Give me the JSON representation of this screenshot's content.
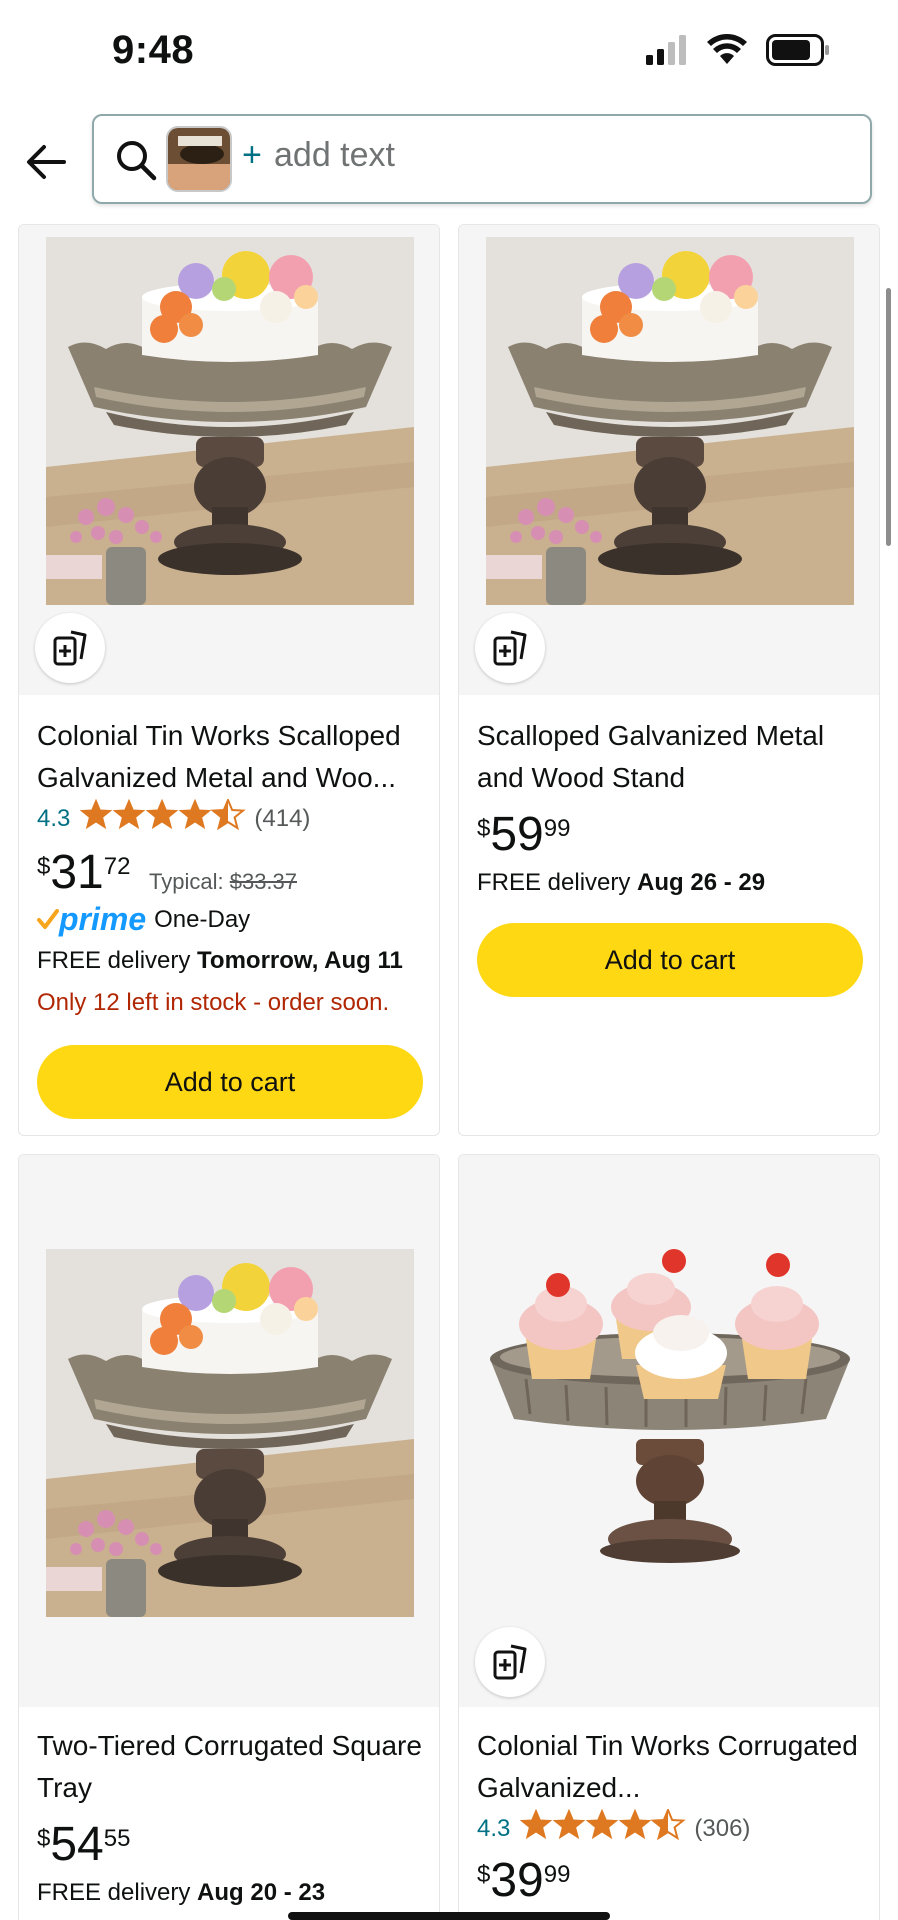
{
  "status": {
    "time": "9:48"
  },
  "search": {
    "placeholder": "add text",
    "plus": "+"
  },
  "products": [
    {
      "title": "Colonial Tin Works Scalloped Galvanized Metal and Woo...",
      "rating": "4.3",
      "rating_value": 4.3,
      "review_count": "(414)",
      "price_currency": "$",
      "price_whole": "31",
      "price_fraction": "72",
      "typical_label": "Typical:",
      "typical_price": "$33.37",
      "prime_word": "prime",
      "prime_label": "One-Day",
      "delivery_prefix": "FREE delivery",
      "delivery_date": "Tomorrow, Aug 11",
      "stock_note": "Only 12 left in stock - order soon.",
      "cart_label": "Add to cart"
    },
    {
      "title": "Scalloped Galvanized Metal and Wood Stand",
      "price_currency": "$",
      "price_whole": "59",
      "price_fraction": "99",
      "delivery_prefix": "FREE delivery",
      "delivery_date": "Aug 26 - 29",
      "cart_label": "Add to cart"
    },
    {
      "title": "Two-Tiered Corrugated Square Tray",
      "price_currency": "$",
      "price_whole": "54",
      "price_fraction": "55",
      "delivery_prefix": "FREE delivery",
      "delivery_date": "Aug 20 - 23"
    },
    {
      "title": "Colonial Tin Works Corrugated Galvanized...",
      "rating": "4.3",
      "rating_value": 4.3,
      "review_count": "(306)",
      "price_currency": "$",
      "price_whole": "39",
      "price_fraction": "99"
    }
  ],
  "colors": {
    "cart_button": "#ffd814",
    "link_teal": "#007185",
    "star_orange": "#de7921",
    "stock_red": "#b12704",
    "prime_blue": "#1399ff"
  },
  "icons": [
    "back-arrow-icon",
    "search-icon",
    "add-to-compare-icon",
    "star-icon",
    "prime-check-icon",
    "signal-icon",
    "wifi-icon",
    "battery-icon"
  ]
}
